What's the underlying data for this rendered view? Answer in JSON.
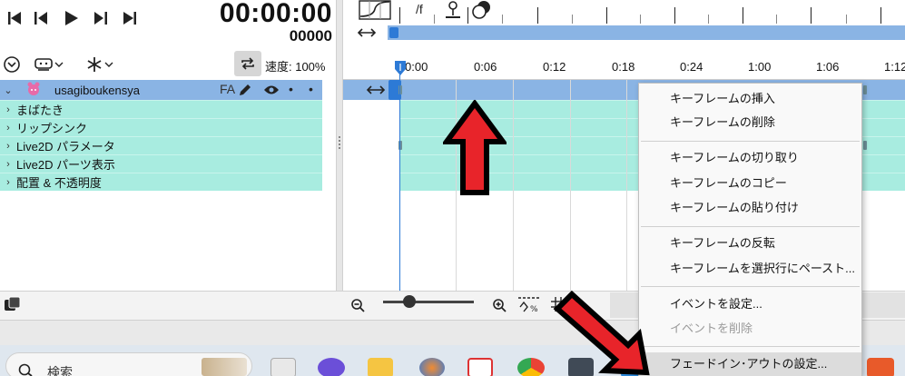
{
  "transport": {
    "timecode": "00:00:00",
    "frames": "00000"
  },
  "toolbar": {
    "speed_label": "速度: 100%"
  },
  "tracks": {
    "main": {
      "name": "usagiboukensya",
      "fa_label": "FA"
    },
    "sub": [
      {
        "label": "まばたき"
      },
      {
        "label": "リップシンク"
      },
      {
        "label": "Live2D パラメータ"
      },
      {
        "label": "Live2D パーツ表示"
      },
      {
        "label": "配置 & 不透明度"
      }
    ]
  },
  "timeline": {
    "fps_label": "/f",
    "ruler_ticks": [
      "0:00",
      "0:06",
      "0:12",
      "0:18",
      "0:24",
      "1:00",
      "1:06",
      "1:12"
    ]
  },
  "context_menu": {
    "items": [
      {
        "label": "キーフレームの挿入",
        "enabled": true
      },
      {
        "label": "キーフレームの削除",
        "enabled": true
      },
      {
        "label": "キーフレームの切り取り",
        "enabled": true
      },
      {
        "label": "キーフレームのコピー",
        "enabled": true
      },
      {
        "label": "キーフレームの貼り付け",
        "enabled": true
      },
      {
        "label": "キーフレームの反転",
        "enabled": true
      },
      {
        "label": "キーフレームを選択行にペースト...",
        "enabled": true
      },
      {
        "label": "イベントを設定...",
        "enabled": true
      },
      {
        "label": "イベントを削除",
        "enabled": false
      },
      {
        "label": "フェードイン･アウトの設定...",
        "enabled": true,
        "highlighted": true
      }
    ]
  },
  "taskbar": {
    "search_placeholder": "検索"
  },
  "colors": {
    "track_main": "#8ab4e4",
    "track_sub": "#a8ece0",
    "playhead": "#2d7ad6",
    "arrow_fill": "#e8242a"
  }
}
